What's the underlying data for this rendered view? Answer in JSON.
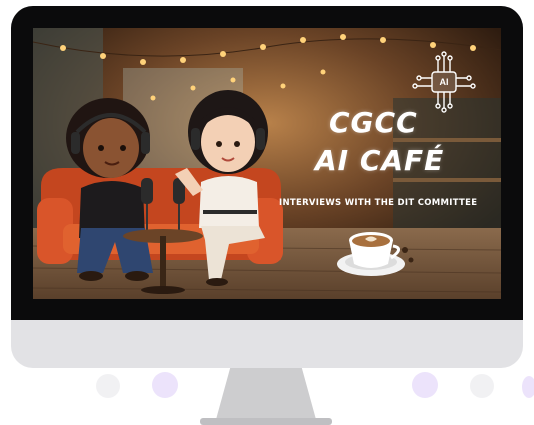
{
  "banner": {
    "title_line1": "CGCC",
    "title_line2": "AI CAFÉ",
    "subtitle": "INTERVIEWS WITH THE DIT COMMITTEE",
    "chip_label": "AI"
  },
  "icons": {
    "chip": "ai-chip-circuit-icon",
    "cup": "coffee-cup-icon"
  },
  "colors": {
    "bezel": "#0b0b0c",
    "chin": "#e2e2e5",
    "stand": "#cdcdcf",
    "sofa": "#d9552a",
    "background_dots": "#ece3fb"
  }
}
